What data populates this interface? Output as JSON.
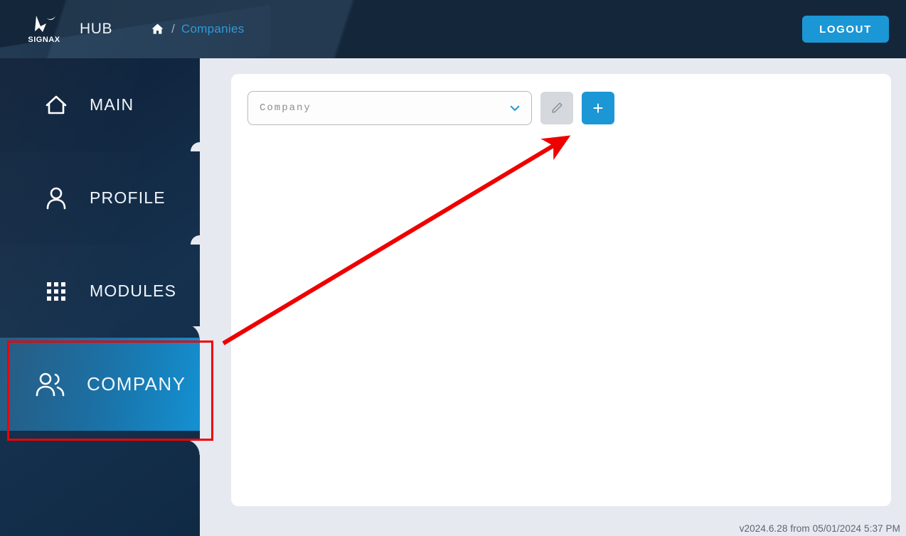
{
  "header": {
    "logo_name": "signax-logo",
    "logo_text": "SIGNAX",
    "app_name": "HUB",
    "breadcrumb": {
      "home_icon": "home-icon",
      "separator": "/",
      "current": "Companies"
    },
    "logout_label": "LOGOUT"
  },
  "sidebar": {
    "items": [
      {
        "label": "MAIN",
        "icon": "home-icon",
        "active": false
      },
      {
        "label": "PROFILE",
        "icon": "person-icon",
        "active": false
      },
      {
        "label": "MODULES",
        "icon": "grid-icon",
        "active": false
      },
      {
        "label": "COMPANY",
        "icon": "people-icon",
        "active": true
      }
    ]
  },
  "main": {
    "company_select": {
      "value": "Company",
      "placeholder": "Company",
      "chevron_icon": "chevron-down-icon"
    },
    "edit_button": {
      "icon": "pencil-icon",
      "label": "",
      "disabled": true
    },
    "add_button": {
      "icon": "plus-icon",
      "label": "+"
    }
  },
  "footer": {
    "version_text": "v2024.6.28 from 05/01/2024 5:37 PM"
  },
  "annotations": {
    "highlight_target": "COMPANY",
    "arrow_points_to": "add-company-button",
    "color": "#ef0000"
  },
  "colors": {
    "accent": "#1b97d5",
    "header_bg": "#14273a",
    "sidebar_top": "#0e2038",
    "page_bg": "#e6e9f0",
    "breadcrumb_link": "#2f9ad8",
    "annotation": "#ef0000"
  }
}
